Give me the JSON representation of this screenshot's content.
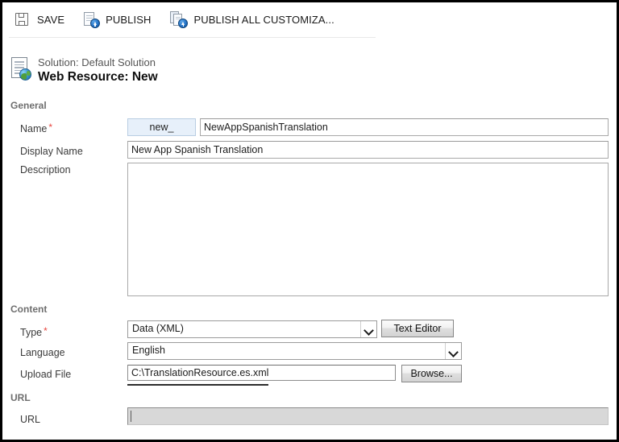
{
  "toolbar": {
    "save": {
      "label": "SAVE",
      "icon": "floppy-disk-icon"
    },
    "publish": {
      "label": "PUBLISH",
      "icon": "publish-page-icon"
    },
    "publish_all": {
      "label": "PUBLISH ALL CUSTOMIZA...",
      "icon": "publish-all-pages-icon"
    }
  },
  "header": {
    "solution": "Solution: Default Solution",
    "title": "Web Resource: New",
    "icon": "web-resource-globe-icon"
  },
  "sections": {
    "general": {
      "title": "General",
      "name": {
        "label": "Name",
        "required": "*",
        "prefix": "new_",
        "value": "NewAppSpanishTranslation"
      },
      "display_name": {
        "label": "Display Name",
        "value": "New App Spanish Translation"
      },
      "description": {
        "label": "Description",
        "value": ""
      }
    },
    "content": {
      "title": "Content",
      "type": {
        "label": "Type",
        "required": "*",
        "value": "Data (XML)"
      },
      "text_editor_button": "Text Editor",
      "language": {
        "label": "Language",
        "value": "English"
      },
      "upload_file": {
        "label": "Upload File",
        "value": "C:\\TranslationResource.es.xml",
        "browse_button": "Browse..."
      }
    },
    "url": {
      "title": "URL",
      "url": {
        "label": "URL",
        "value": ""
      }
    }
  },
  "colors": {
    "accent_blue": "#1f6fc4",
    "required_red": "#e8473f",
    "prefix_bg": "#e7f0fa",
    "disabled_bg": "#d8d8d8"
  }
}
